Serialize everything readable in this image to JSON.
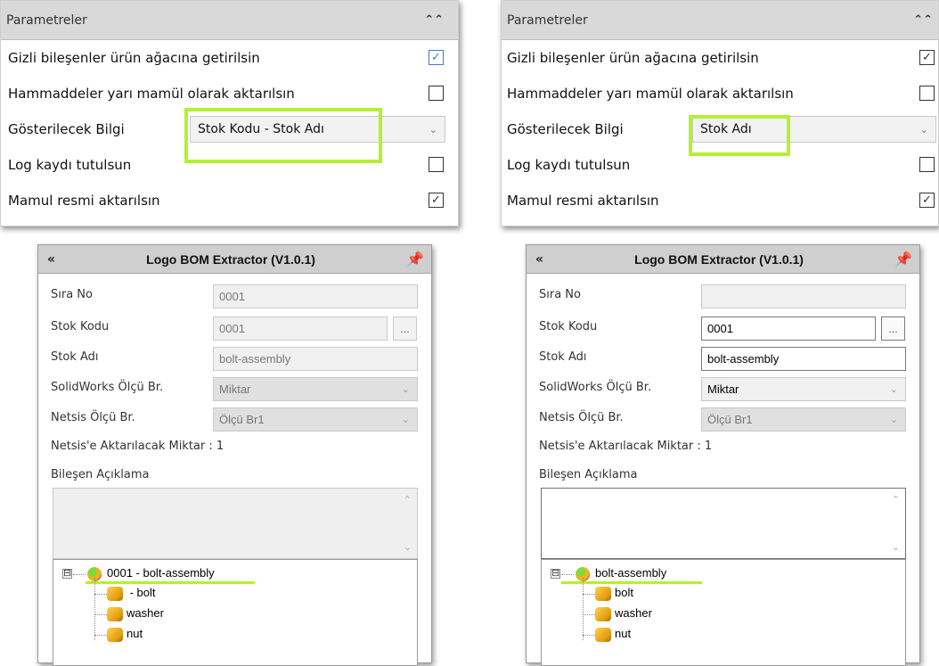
{
  "params_left": {
    "title": "Parametreler",
    "rows": [
      {
        "label": "Gizli bileşenler ürün ağacına getirilsin",
        "checked": true
      },
      {
        "label": "Hammaddeler yarı mamül olarak aktarılsın",
        "checked": false
      },
      {
        "label": "Gösterilecek Bilgi",
        "select_value": "Stok Kodu - Stok Adı"
      },
      {
        "label": "Log kaydı tutulsun",
        "checked": false
      },
      {
        "label": "Mamul resmi aktarılsın",
        "checked": true
      }
    ]
  },
  "params_right": {
    "title": "Parametreler",
    "rows": [
      {
        "label": "Gizli bileşenler ürün ağacına getirilsin",
        "checked": true
      },
      {
        "label": "Hammaddeler yarı mamül olarak aktarılsın",
        "checked": false
      },
      {
        "label": "Gösterilecek Bilgi",
        "select_value": "Stok Adı"
      },
      {
        "label": "Log kaydı tutulsun",
        "checked": false
      },
      {
        "label": "Mamul resmi aktarılsın",
        "checked": true
      }
    ]
  },
  "bom_left": {
    "title": "Logo BOM Extractor (V1.0.1)",
    "sira_no_label": "Sıra No",
    "sira_no_value": "0001",
    "stok_kodu_label": "Stok Kodu",
    "stok_kodu_value": "0001",
    "browse_label": "...",
    "stok_adi_label": "Stok Adı",
    "stok_adi_value": "bolt-assembly",
    "sw_unit_label": "SolidWorks Ölçü Br.",
    "sw_unit_value": "Miktar",
    "netsis_unit_label": "Netsis Ölçü Br.",
    "netsis_unit_value": "Ölçü Br1",
    "quantity_text": "Netsis'e Aktarılacak Miktar : 1",
    "desc_label": "Bileşen Açıklama",
    "tree": {
      "expander": "⊟",
      "root": "0001 - bolt-assembly",
      "children": [
        " - bolt",
        "washer",
        "nut"
      ]
    }
  },
  "bom_right": {
    "title": "Logo BOM Extractor (V1.0.1)",
    "sira_no_label": "Sıra No",
    "sira_no_value": "",
    "stok_kodu_label": "Stok Kodu",
    "stok_kodu_value": "0001",
    "browse_label": "...",
    "stok_adi_label": "Stok Adı",
    "stok_adi_value": "bolt-assembly",
    "sw_unit_label": "SolidWorks Ölçü Br.",
    "sw_unit_value": "Miktar",
    "netsis_unit_label": "Netsis Ölçü Br.",
    "netsis_unit_value": "Ölçü Br1",
    "quantity_text": "Netsis'e Aktarılacak Miktar : 1",
    "desc_label": "Bileşen Açıklama",
    "tree": {
      "expander": "⊟",
      "root": "bolt-assembly",
      "children": [
        "bolt",
        "washer",
        "nut"
      ]
    }
  },
  "icons": {
    "collapse": "double-chevron-up-icon",
    "expand_left": "double-chevron-left-icon",
    "pin": "pin-icon",
    "dropdown": "chevron-down-icon",
    "checkmark": "checkmark-icon",
    "scroll_up": "scroll-up-arrow-icon",
    "scroll_down": "scroll-down-arrow-icon"
  },
  "colors": {
    "highlight": "#b4f032",
    "checkbox_checked_blue": "#3a7bd5",
    "header_gray": "#d9d9d9"
  }
}
